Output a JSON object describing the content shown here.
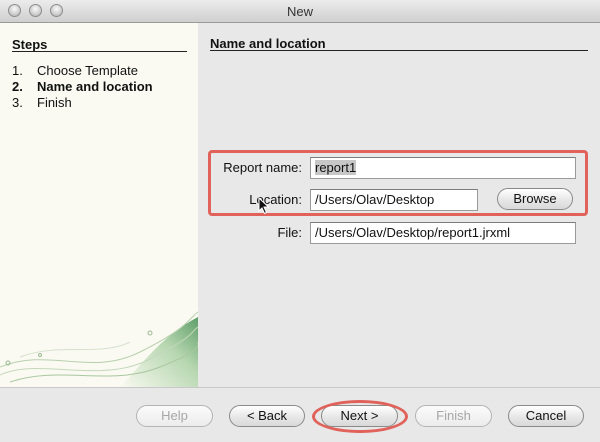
{
  "window": {
    "title": "New"
  },
  "steps": {
    "heading": "Steps",
    "items": [
      {
        "num": "1.",
        "label": "Choose Template"
      },
      {
        "num": "2.",
        "label": "Name and location"
      },
      {
        "num": "3.",
        "label": "Finish"
      }
    ]
  },
  "content": {
    "heading": "Name and location",
    "report_name": {
      "label": "Report name:",
      "value": "report1"
    },
    "location": {
      "label": "Location:",
      "value": "/Users/Olav/Desktop"
    },
    "browse_label": "Browse",
    "file": {
      "label": "File:",
      "value": "/Users/Olav/Desktop/report1.jrxml"
    }
  },
  "buttons": {
    "help": "Help",
    "back": "< Back",
    "next": "Next >",
    "finish": "Finish",
    "cancel": "Cancel"
  },
  "colors": {
    "highlight": "#e0625a"
  }
}
